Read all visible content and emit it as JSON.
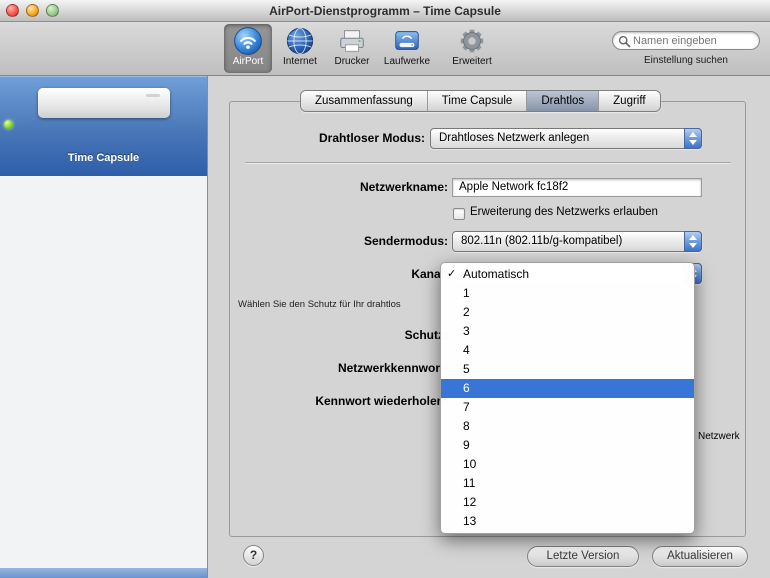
{
  "window": {
    "title": "AirPort-Dienstprogramm – Time Capsule"
  },
  "toolbar": {
    "items": [
      {
        "label": "AirPort",
        "selected": true
      },
      {
        "label": "Internet",
        "selected": false
      },
      {
        "label": "Drucker",
        "selected": false
      },
      {
        "label": "Laufwerke",
        "selected": false
      },
      {
        "label": "Erweitert",
        "selected": false
      }
    ],
    "search_placeholder": "Namen eingeben",
    "search_caption": "Einstellung suchen"
  },
  "sidebar": {
    "device": {
      "label": "Time Capsule",
      "status": "online-green"
    }
  },
  "tabs": [
    {
      "label": "Zusammenfassung",
      "selected": false
    },
    {
      "label": "Time Capsule",
      "selected": false
    },
    {
      "label": "Drahtlos",
      "selected": true
    },
    {
      "label": "Zugriff",
      "selected": false
    }
  ],
  "form": {
    "wireless_mode_label": "Drahtloser Modus:",
    "wireless_mode_value": "Drahtloses Netzwerk anlegen",
    "network_name_label": "Netzwerkname:",
    "network_name_value": "Apple Network fc18f2",
    "extend_checkbox_label": "Erweiterung des Netzwerks erlauben",
    "extend_checkbox_checked": false,
    "radio_mode_label": "Sendermodus:",
    "radio_mode_value": "802.11n (802.11b/g-kompatibel)",
    "channel_label": "Kanal:",
    "security_hint_fragment": "Wählen Sie den Schutz für Ihr drahtlos",
    "security_label": "Schutz:",
    "network_password_label": "Netzwerkkennwort:",
    "verify_password_label": "Kennwort wiederholen:",
    "right_text_fragment": "Netzwerk"
  },
  "channel_menu": {
    "check_glyph": "✓",
    "checked_item": "Automatisch",
    "highlighted_item": "6",
    "items": [
      "Automatisch",
      "1",
      "2",
      "3",
      "4",
      "5",
      "6",
      "7",
      "8",
      "9",
      "10",
      "11",
      "12",
      "13"
    ]
  },
  "footer": {
    "help_label": "?",
    "revert_button": "Letzte Version",
    "update_button": "Aktualisieren"
  },
  "colors": {
    "menu_highlight": "#3875d7",
    "sidebar_selection": "#4a77b8",
    "popup_cap_blue": "#3f74c6"
  }
}
